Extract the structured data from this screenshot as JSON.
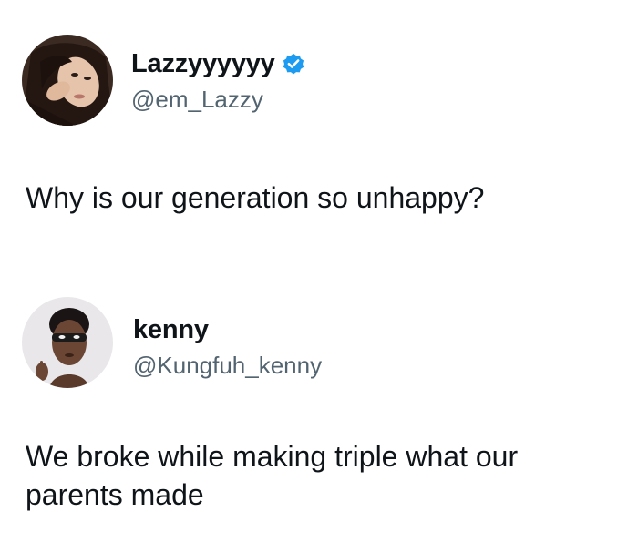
{
  "posts": [
    {
      "display_name": "Lazzyyyyyy",
      "verified": true,
      "handle": "@em_Lazzy",
      "text": "Why is our generation so unhappy?",
      "avatar_icon": "woman-portrait-avatar"
    },
    {
      "display_name": "kenny",
      "verified": false,
      "handle": "@Kungfuh_kenny",
      "text": "We broke while making triple what our parents made",
      "avatar_icon": "man-portrait-avatar"
    }
  ],
  "colors": {
    "text_primary": "#0f1419",
    "text_secondary": "#536471",
    "verified_badge": "#1d9bf0",
    "background": "#ffffff"
  }
}
